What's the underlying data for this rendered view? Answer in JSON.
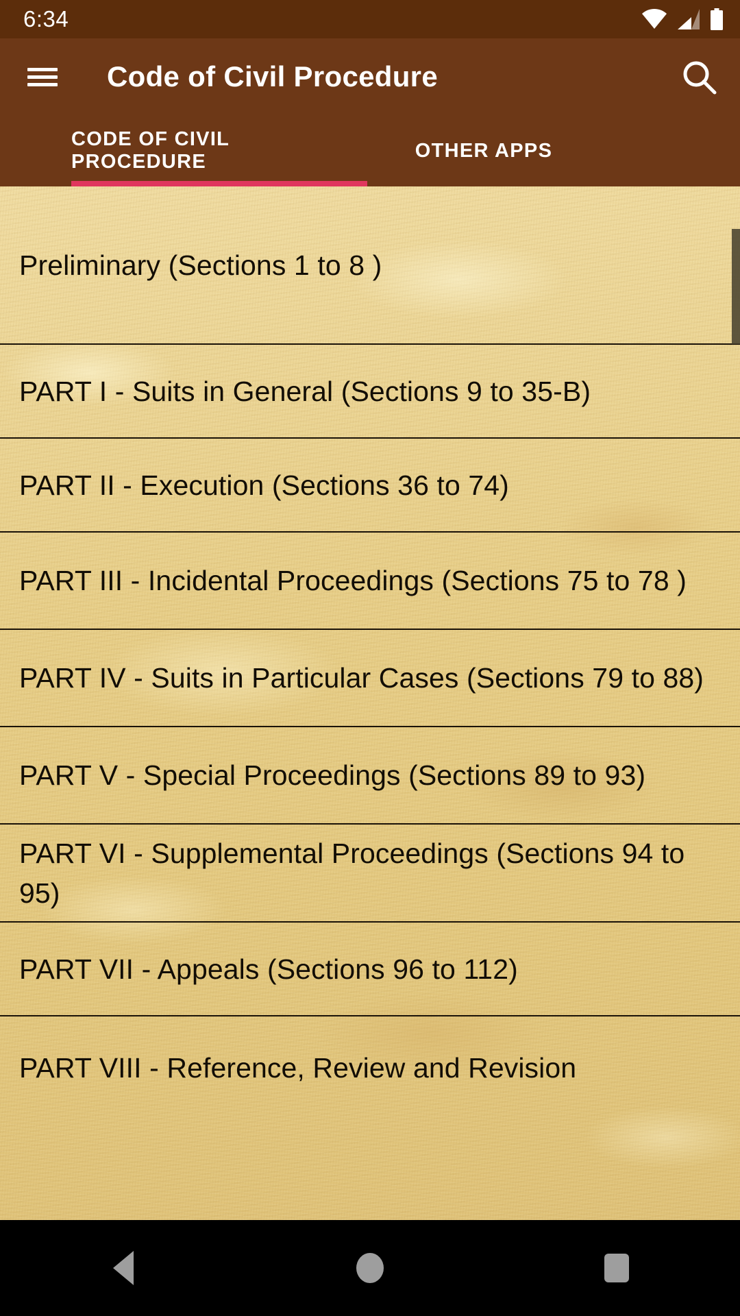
{
  "status_bar": {
    "time": "6:34",
    "icons": [
      "wifi-icon",
      "cellular-signal-icon",
      "battery-icon"
    ],
    "background_color": "#5C2D0B"
  },
  "app_bar": {
    "menu_icon": "hamburger-menu-icon",
    "title": "Code of Civil Procedure",
    "search_icon": "search-icon",
    "background_color": "#6D3817"
  },
  "tabs": {
    "items": [
      {
        "label": "CODE OF CIVIL PROCEDURE",
        "selected": true
      },
      {
        "label": "OTHER APPS",
        "selected": false
      }
    ],
    "indicator_color": "#E0365E"
  },
  "list": {
    "background_color": "#E9D292",
    "text_color": "#120d05",
    "items": [
      {
        "label": "Preliminary (Sections 1 to 8 )"
      },
      {
        "label": "PART I - Suits in General (Sections 9 to 35-B)"
      },
      {
        "label": "PART II - Execution (Sections 36 to 74)"
      },
      {
        "label": "PART III - Incidental Proceedings (Sections 75 to 78 )"
      },
      {
        "label": "PART IV - Suits in Particular Cases (Sections 79 to 88)"
      },
      {
        "label": "PART V - Special Proceedings (Sections 89 to 93)"
      },
      {
        "label": "PART VI - Supplemental Proceedings (Sections 94 to 95)"
      },
      {
        "label": "PART VII - Appeals (Sections 96 to 112)"
      },
      {
        "label": "PART VIII - Reference, Review and Revision"
      }
    ]
  },
  "scrollbar": {
    "name": "vertical-scrollbar"
  },
  "nav_bar": {
    "back": "back-triangle-icon",
    "home": "home-circle-icon",
    "recents": "recents-square-icon",
    "background_color": "#000000"
  }
}
